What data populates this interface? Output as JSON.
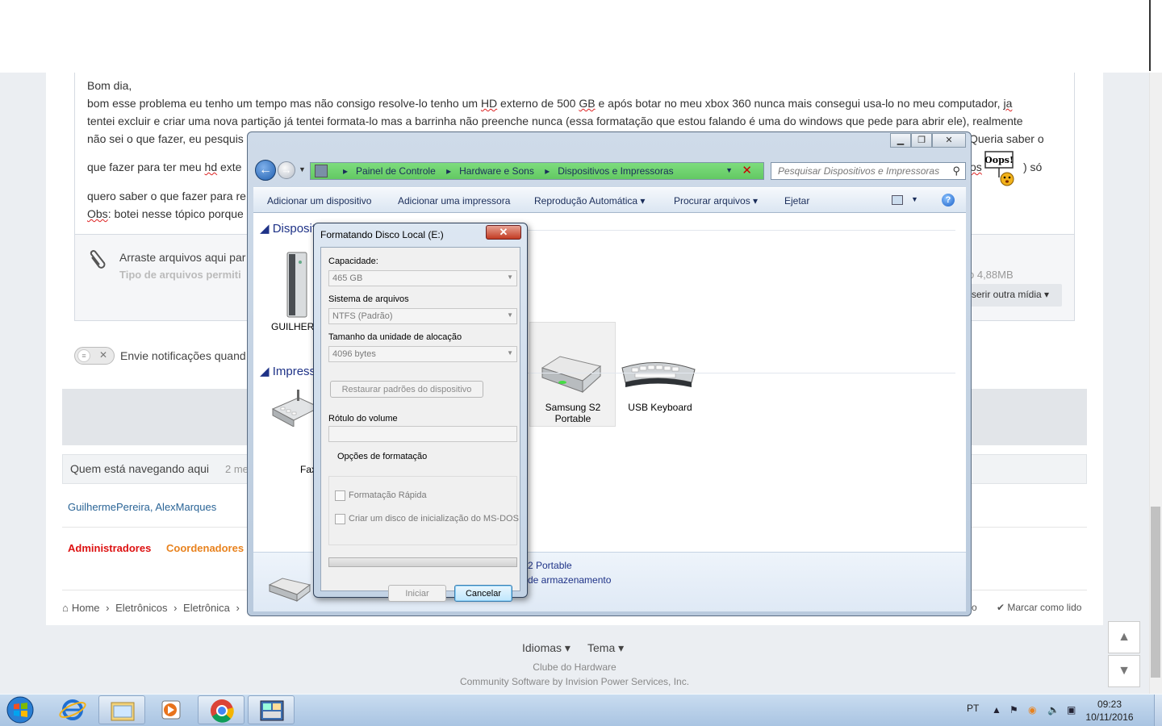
{
  "post": {
    "line1": "Bom dia,",
    "line2a": "bom esse problema eu tenho um tempo mas não consigo resolve-lo tenho um ",
    "line2_hd": "HD",
    "line2b": " externo de 500 ",
    "line2_gb": "GB",
    "line2c": " e  após botar no meu xbox 360 nunca mais consegui usa-lo no meu computador, ",
    "line2_ja": "ja",
    "line3": "tentei excluir e criar uma nova partição já tentei formata-lo mas a barrinha não preenche nunca (essa formatação que estou falando é uma do windows que pede para abrir ele), realmente",
    "line4a": "não sei o que fazer, eu pesquis",
    "line4b": "Queria saber o",
    "line5a": "que fazer para ter meu ",
    "line5_hd": "hd",
    "line5b": " exte",
    "line5_tail_os": "os",
    "line5_tail": ") só",
    "line6": "quero saber o que fazer para re",
    "line7_obs": "Obs",
    "line7": ": botei nesse tópico porque",
    "oops": "Oops!"
  },
  "attach": {
    "title": "Arraste arquivos aqui par",
    "subtitle": "Tipo de arquivos permiti",
    "max": "o 4,88MB",
    "media_button": "serir outra mídia"
  },
  "notify": "Envie notificações quand",
  "browsing": {
    "title": "Quem está navegando aqui",
    "count": "2 me",
    "users": "GuilhermePereira,  AlexMarques",
    "admins": "Administradores",
    "coords": "Coordenadores"
  },
  "breadcrumb": [
    "Home",
    "Eletrônicos",
    "Eletrônica"
  ],
  "breadcrumb_tail": "o",
  "mark_read": "Marcar como lido",
  "footer": {
    "lang": "Idiomas",
    "theme": "Tema",
    "site": "Clube do Hardware",
    "software": "Community Software by Invision Power Services, Inc."
  },
  "explorer": {
    "address": [
      "Painel de Controle",
      "Hardware e Sons",
      "Dispositivos e Impressoras"
    ],
    "search_placeholder": "Pesquisar Dispositivos e Impressoras",
    "commands": [
      "Adicionar um dispositivo",
      "Adicionar uma impressora",
      "Reprodução Automática",
      "Procurar arquivos",
      "Ejetar"
    ],
    "section_devices": "Disposit",
    "section_printers": "Impress",
    "devices": [
      {
        "label": "GUILHERM"
      },
      {
        "label": "Samsung S2 Portable"
      },
      {
        "label": "USB Keyboard"
      }
    ],
    "printer": "Fax",
    "details_name": "2 Portable",
    "details_cat": "de armazenamento"
  },
  "format": {
    "title": "Formatando Disco Local (E:)",
    "capacity_label": "Capacidade:",
    "capacity_value": "465 GB",
    "fs_label": "Sistema de arquivos",
    "fs_value": "NTFS (Padrão)",
    "alloc_label": "Tamanho da unidade de alocação",
    "alloc_value": "4096 bytes",
    "restore_button": "Restaurar padrões do dispositivo",
    "volume_label": "Rótulo do volume",
    "volume_value": "",
    "options_label": "Opções de formatação",
    "quick_format": "Formatação Rápida",
    "msdos": "Criar um disco de inicialização do MS-DOS",
    "progress": 0,
    "start_button": "Iniciar",
    "cancel_button": "Cancelar"
  },
  "taskbar": {
    "lang": "PT",
    "time": "09:23",
    "date": "10/11/2016"
  }
}
